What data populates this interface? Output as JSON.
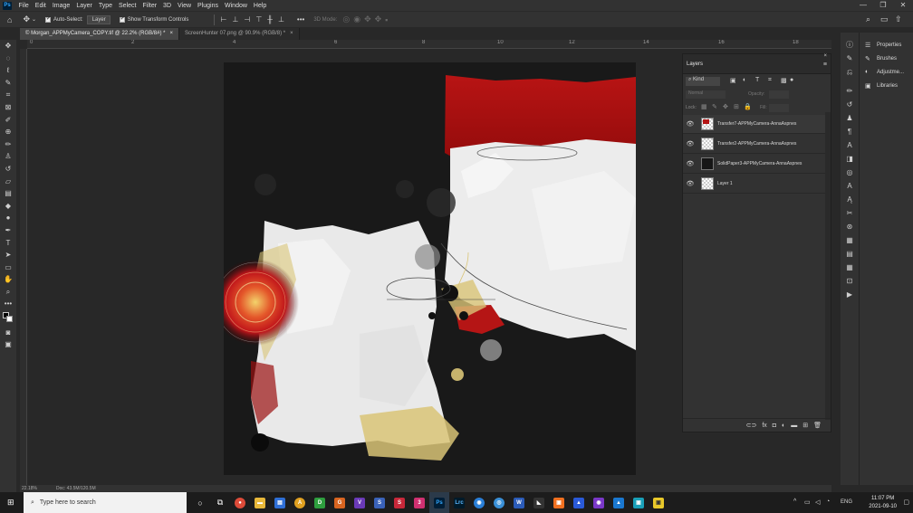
{
  "menubar": {
    "logo": "Ps",
    "items": [
      "File",
      "Edit",
      "Image",
      "Layer",
      "Type",
      "Select",
      "Filter",
      "3D",
      "View",
      "Plugins",
      "Window",
      "Help"
    ],
    "window_controls": [
      "—",
      "❐",
      "✕"
    ]
  },
  "options": {
    "auto_select_label": "Auto-Select:",
    "auto_select_value": "Layer",
    "show_transform_label": "Show Transform Controls",
    "mode_3d_label": "3D Mode:"
  },
  "tabs": [
    {
      "label": "© Morgan_APPMyCamera_COPY.tif @ 22.2% (RGB/8#) *",
      "close": "×"
    },
    {
      "label": "ScreenHunter 07.png @ 90.9% (RGB/8) *",
      "close": "×"
    }
  ],
  "ruler_labels": [
    "0",
    "2",
    "4",
    "6",
    "8",
    "10",
    "12",
    "14",
    "16",
    "18"
  ],
  "status": {
    "zoom": "22.18%",
    "doc": "Doc: 43.5M/120.5M"
  },
  "layers_panel": {
    "title": "Layers",
    "filter_kind": "Kind",
    "blend_mode": "Normal",
    "opacity_label": "Opacity:",
    "lock_label": "Lock:",
    "fill_label": "Fill:",
    "layers": [
      {
        "name": "Transfer7-APPMyCamera-AnnaAspnes",
        "thumb": "transfer7"
      },
      {
        "name": "Transfer2-APPMyCamera-AnnaAspnes",
        "thumb": "transfer2"
      },
      {
        "name": "SolidPaper3-APPMyCamera-AnnaAspnes",
        "thumb": "solidpaper"
      },
      {
        "name": "Layer 1",
        "thumb": "empty"
      }
    ]
  },
  "right_panels": [
    {
      "label": "Properties",
      "icon": "properties-icon"
    },
    {
      "label": "Brushes",
      "icon": "brushes-icon"
    },
    {
      "label": "Adjustme...",
      "icon": "adjustments-icon"
    },
    {
      "label": "Libraries",
      "icon": "libraries-icon"
    }
  ],
  "taskbar": {
    "search_placeholder": "Type here to search",
    "language": "ENG",
    "time": "11:07 PM",
    "date": "2021-09-10"
  },
  "colors": {
    "chrome": "#323232",
    "canvas_bg": "#282828",
    "artwork_black": "#161616",
    "accent_red": "#b51515",
    "paper_white": "#ececec",
    "gold": "#d9c477"
  }
}
